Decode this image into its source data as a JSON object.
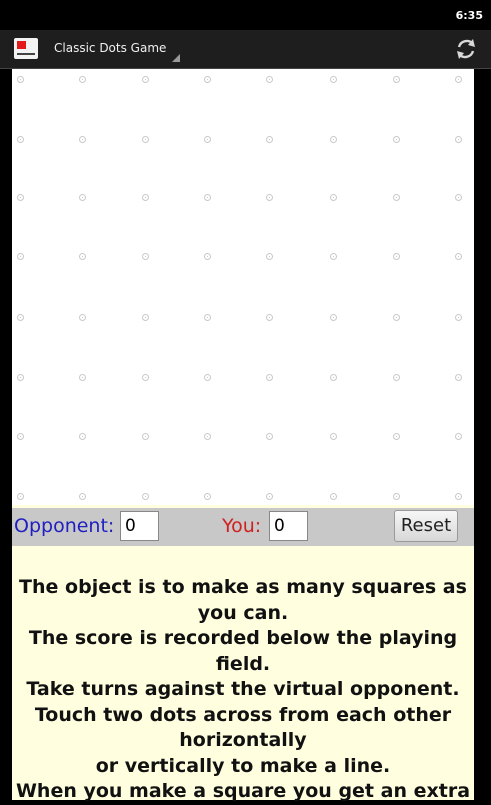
{
  "status_bar": {
    "time": "6:35"
  },
  "action_bar": {
    "title": "Classic Dots Game",
    "refresh_icon": "refresh-icon",
    "app_icon": "app-icon"
  },
  "colors": {
    "opponent": "#2020c0",
    "you": "#d02020",
    "content_bg": "#ffffe0",
    "score_bar_bg": "#c8c8c8"
  },
  "board": {
    "rows": 8,
    "cols": 8
  },
  "score": {
    "opponent_label": "Opponent:",
    "opponent_value": "0",
    "you_label": "You:",
    "you_value": "0",
    "reset_label": "Reset"
  },
  "instructions": [
    "The object is to make as many squares as",
    "you can.",
    "The score is recorded below the playing",
    "field.",
    "Take turns against the virtual opponent.",
    "Touch two dots across from each other",
    "horizontally",
    "or vertically to make a line.",
    "When you make a square you get an extra"
  ]
}
